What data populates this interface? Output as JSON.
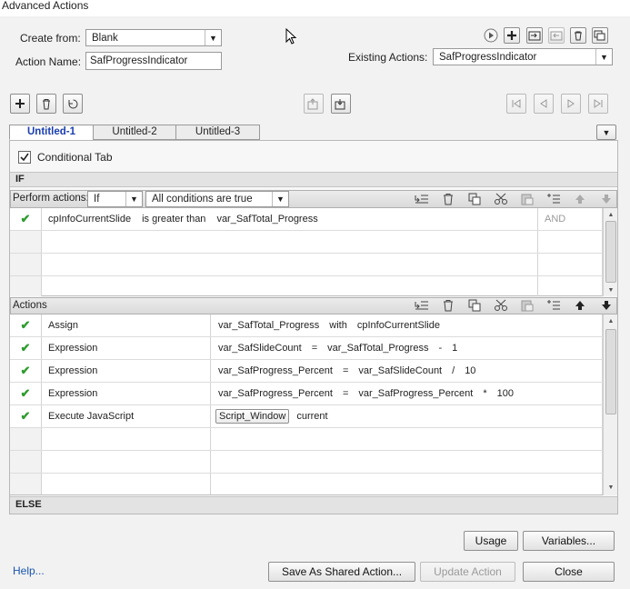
{
  "window": {
    "title": "Advanced Actions"
  },
  "header": {
    "create_from_label": "Create from:",
    "create_from_value": "Blank",
    "action_name_label": "Action Name:",
    "action_name_value": "SafProgressIndicator",
    "existing_actions_label": "Existing Actions:",
    "existing_actions_value": "SafProgressIndicator"
  },
  "tabs": [
    {
      "label": "Untitled-1",
      "active": true
    },
    {
      "label": "Untitled-2",
      "active": false
    },
    {
      "label": "Untitled-3",
      "active": false
    }
  ],
  "conditional_tab": {
    "label": "Conditional Tab",
    "checked": true
  },
  "if_section": {
    "header": "IF",
    "perform_label": "Perform actions:",
    "perform_value": "If",
    "conditions_value": "All conditions are true",
    "conditions": [
      {
        "variable": "cpInfoCurrentSlide",
        "operator": "is greater than",
        "operand": "var_SafTotal_Progress",
        "logic": "AND"
      }
    ]
  },
  "actions_section": {
    "header": "Actions",
    "rows": [
      {
        "type": "Assign",
        "parts": [
          "var_SafTotal_Progress",
          "with",
          "cpInfoCurrentSlide"
        ]
      },
      {
        "type": "Expression",
        "parts": [
          "var_SafSlideCount",
          "=",
          "var_SafTotal_Progress",
          "-",
          "1"
        ]
      },
      {
        "type": "Expression",
        "parts": [
          "var_SafProgress_Percent",
          "=",
          "var_SafSlideCount",
          "/",
          "10"
        ]
      },
      {
        "type": "Expression",
        "parts": [
          "var_SafProgress_Percent",
          "=",
          "var_SafProgress_Percent",
          "*",
          "100"
        ]
      },
      {
        "type": "Execute JavaScript",
        "script_button": "Script_Window",
        "window_value": "current"
      }
    ]
  },
  "else_section": {
    "header": "ELSE"
  },
  "buttons": {
    "usage": "Usage",
    "variables": "Variables...",
    "help": "Help...",
    "save_shared": "Save As Shared Action...",
    "update": "Update Action",
    "close": "Close"
  },
  "colors": {
    "check": "#2e9c2e",
    "active_tab": "#1a3fb0",
    "help_link": "#1a56b0"
  }
}
